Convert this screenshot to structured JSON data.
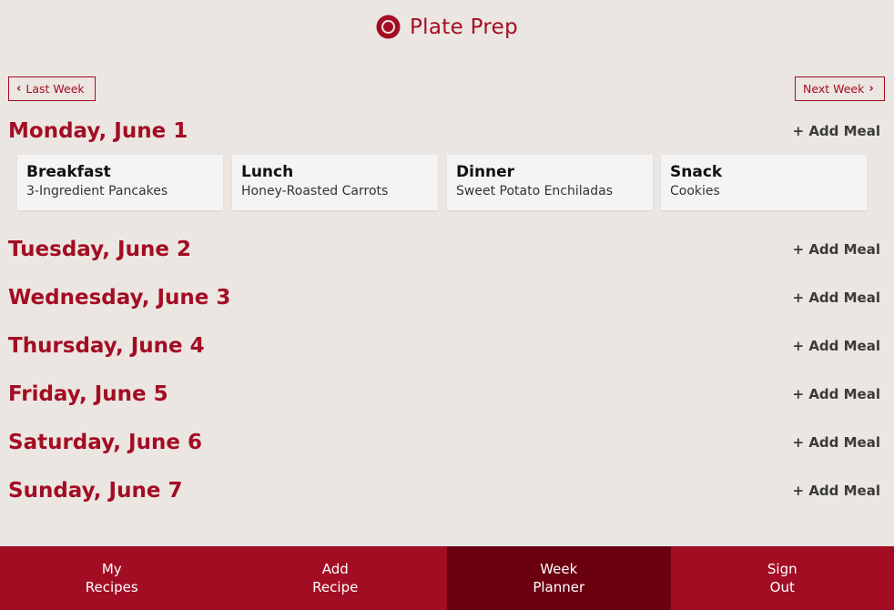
{
  "app": {
    "title": "Plate Prep",
    "logo_icon": "plate-icon",
    "accent_color": "#a30d24"
  },
  "week_nav": {
    "prev_label": "Last Week",
    "next_label": "Next Week"
  },
  "add_meal_label": "+ Add Meal",
  "days": [
    {
      "title": "Monday, June 1",
      "meals": [
        {
          "type": "Breakfast",
          "name": "3-Ingredient Pancakes"
        },
        {
          "type": "Lunch",
          "name": "Honey-Roasted Carrots"
        },
        {
          "type": "Dinner",
          "name": "Sweet Potato Enchiladas"
        },
        {
          "type": "Snack",
          "name": "Cookies"
        }
      ]
    },
    {
      "title": "Tuesday, June 2",
      "meals": []
    },
    {
      "title": "Wednesday, June 3",
      "meals": []
    },
    {
      "title": "Thursday, June 4",
      "meals": []
    },
    {
      "title": "Friday, June 5",
      "meals": []
    },
    {
      "title": "Saturday, June 6",
      "meals": []
    },
    {
      "title": "Sunday, June 7",
      "meals": []
    }
  ],
  "bottom_nav": {
    "active": "Week Planner",
    "items": [
      {
        "line1": "My",
        "line2": "Recipes"
      },
      {
        "line1": "Add",
        "line2": "Recipe"
      },
      {
        "line1": "Week",
        "line2": "Planner"
      },
      {
        "line1": "Sign",
        "line2": "Out"
      }
    ]
  }
}
